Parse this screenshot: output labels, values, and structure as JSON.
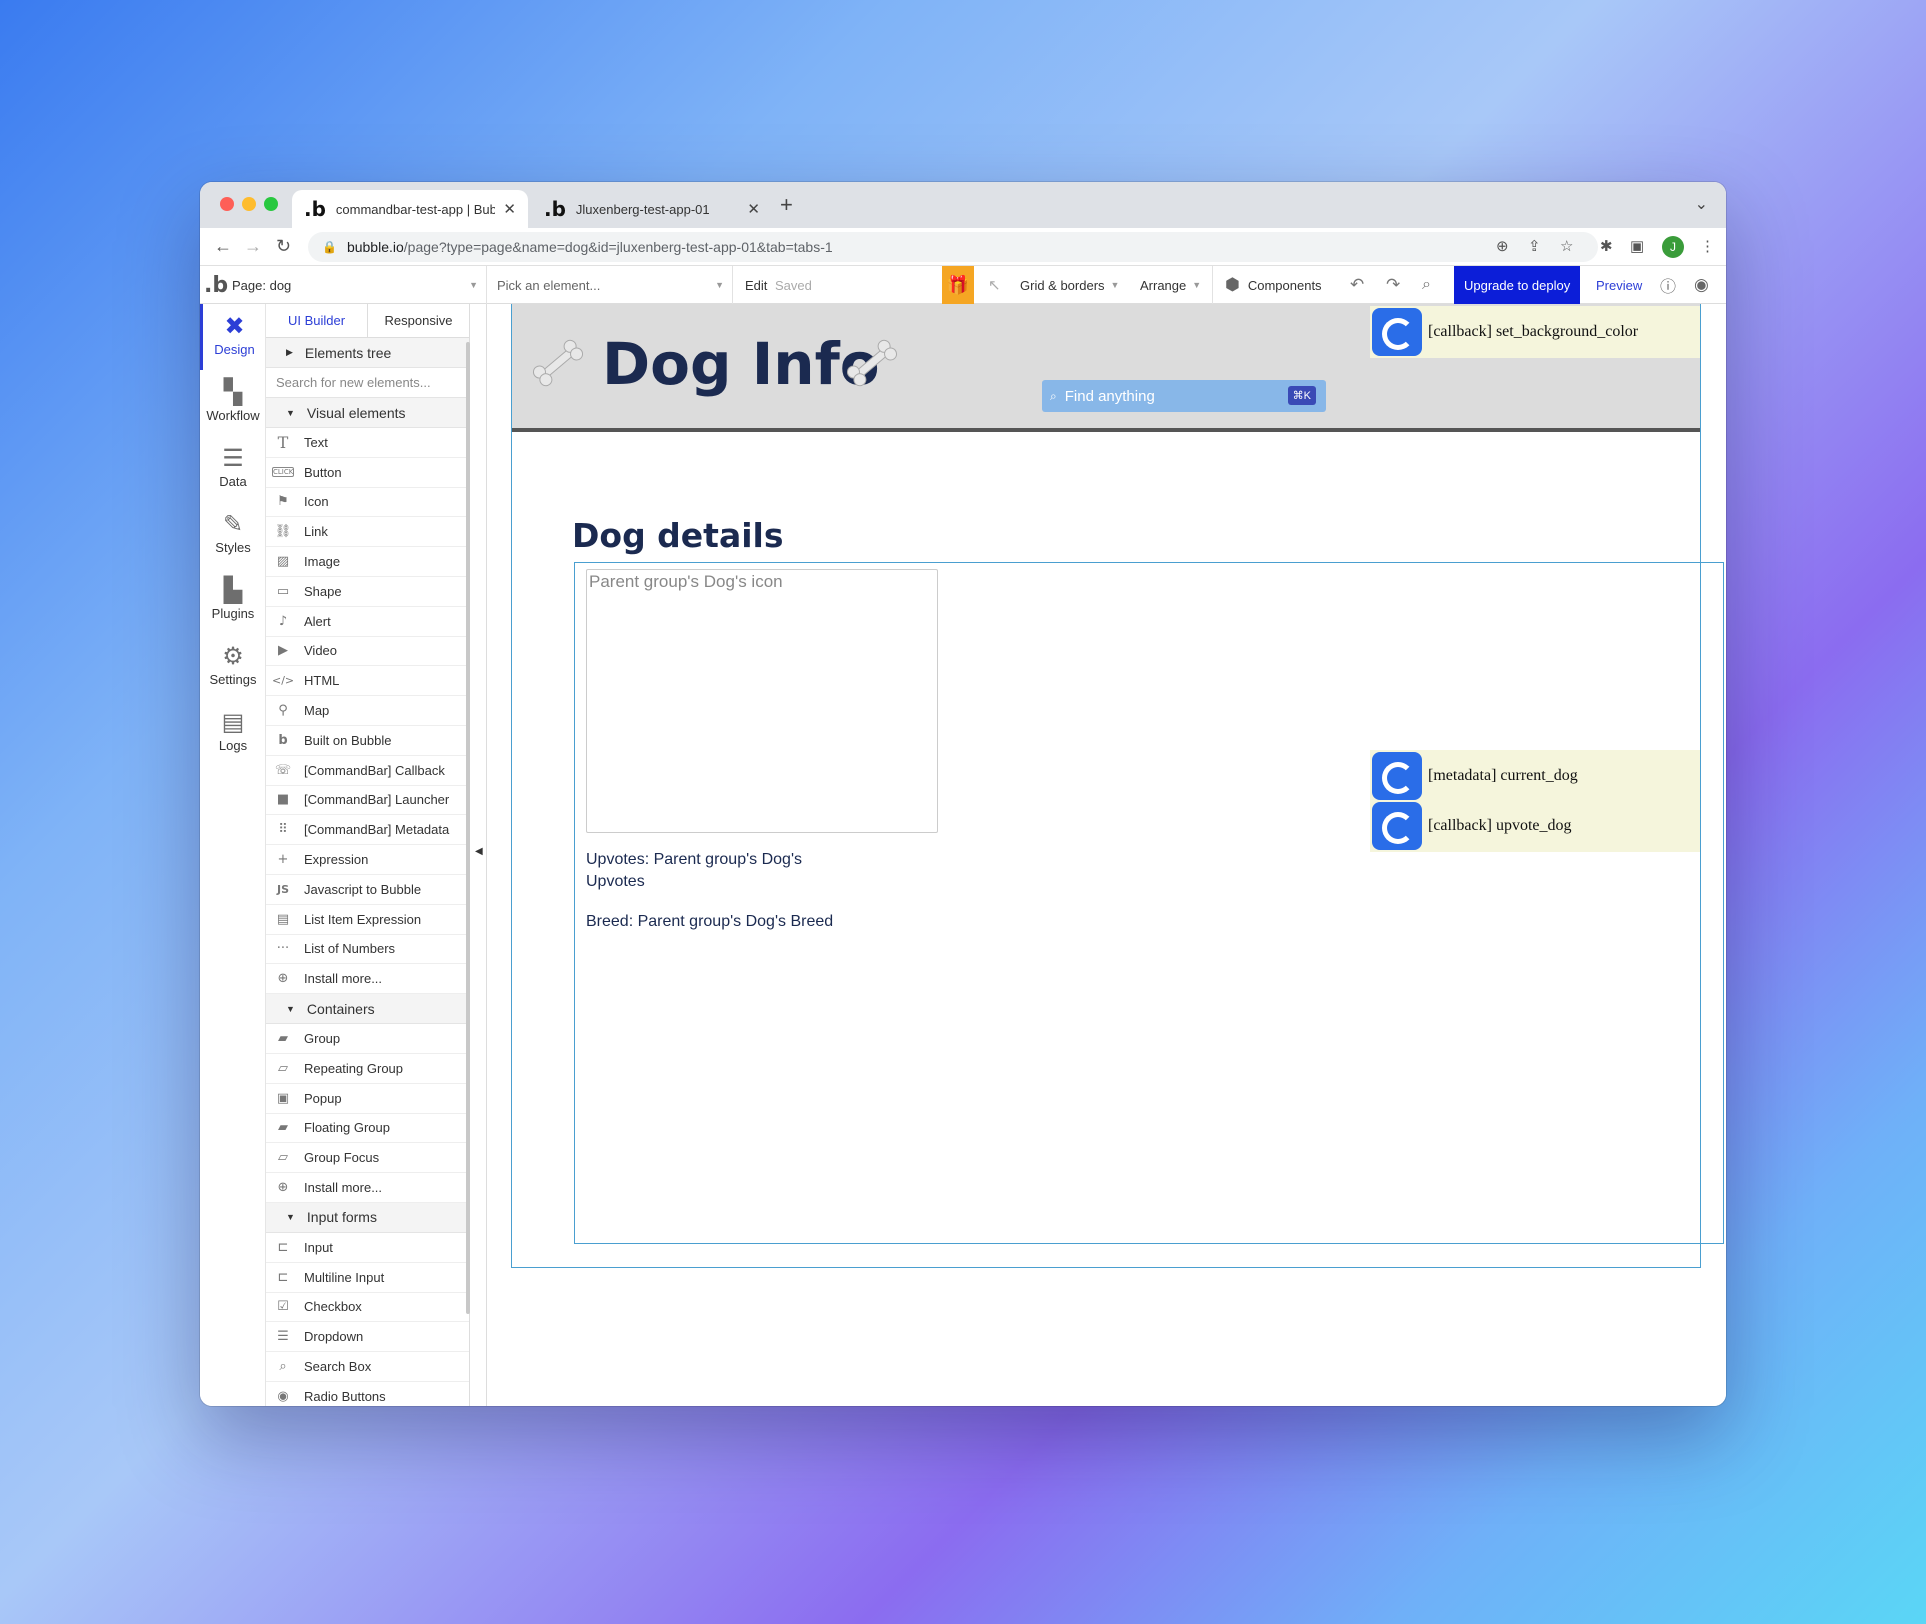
{
  "browser": {
    "tabs": [
      {
        "title": "commandbar-test-app | Bubble"
      },
      {
        "title": "Jluxenberg-test-app-01"
      }
    ],
    "url_host": "bubble.io",
    "url_path": "/page?type=page&name=dog&id=jluxenberg-test-app-01&tab=tabs-1",
    "profile_initial": "J"
  },
  "toolbar": {
    "page_label": "Page: dog",
    "element_placeholder": "Pick an element...",
    "edit": "Edit",
    "saved": "Saved",
    "grid": "Grid & borders",
    "arrange": "Arrange",
    "components": "Components",
    "upgrade": "Upgrade to deploy",
    "preview": "Preview"
  },
  "rail": [
    {
      "label": "Design",
      "icon": "design-icon"
    },
    {
      "label": "Workflow",
      "icon": "workflow-icon"
    },
    {
      "label": "Data",
      "icon": "database-icon"
    },
    {
      "label": "Styles",
      "icon": "brush-icon"
    },
    {
      "label": "Plugins",
      "icon": "plugin-icon"
    },
    {
      "label": "Settings",
      "icon": "gear-icon"
    },
    {
      "label": "Logs",
      "icon": "document-icon"
    }
  ],
  "palette": {
    "tab_ui": "UI Builder",
    "tab_responsive": "Responsive",
    "elements_tree": "Elements tree",
    "search_placeholder": "Search for new elements...",
    "visual_header": "Visual elements",
    "visual": [
      "Text",
      "Button",
      "Icon",
      "Link",
      "Image",
      "Shape",
      "Alert",
      "Video",
      "HTML",
      "Map",
      "Built on Bubble",
      "[CommandBar] Callback",
      "[CommandBar] Launcher",
      "[CommandBar] Metadata",
      "Expression",
      "Javascript to Bubble",
      "List Item Expression",
      "List of Numbers",
      "Install more..."
    ],
    "containers_header": "Containers",
    "containers": [
      "Group",
      "Repeating Group",
      "Popup",
      "Floating Group",
      "Group Focus",
      "Install more..."
    ],
    "inputs_header": "Input forms",
    "inputs": [
      "Input",
      "Multiline Input",
      "Checkbox",
      "Dropdown",
      "Search Box",
      "Radio Buttons"
    ]
  },
  "canvas": {
    "title": "Dog Info",
    "find_placeholder": "Find anything",
    "find_shortcut": "⌘K",
    "callback_bg": "[callback] set_background_color",
    "metadata_dog": "[metadata] current_dog",
    "callback_upvote": "[callback] upvote_dog",
    "details_heading": "Dog details",
    "icon_placeholder": "Parent group's Dog's icon",
    "upvotes_text": "Upvotes: Parent group's Dog's Upvotes",
    "breed_text": "Breed: Parent group's Dog's Breed"
  }
}
